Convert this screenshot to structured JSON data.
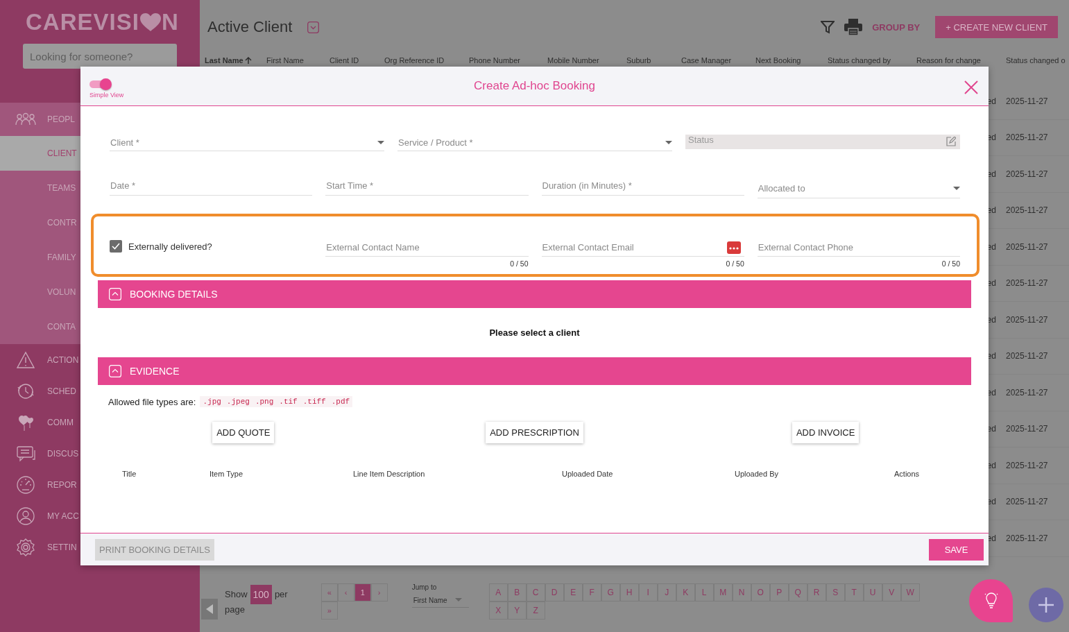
{
  "sidebar": {
    "logo": {
      "before": "CAREVISI",
      "after": "N"
    },
    "search": {
      "placeholder": "Looking for someone?"
    },
    "items": [
      {
        "label": "PEOPL",
        "expanded": true,
        "children": [
          {
            "label": "CLIENT",
            "selected": true
          },
          {
            "label": "TEAMS",
            "selected": false
          },
          {
            "label": "CONTR",
            "selected": false
          },
          {
            "label": "FAMILY",
            "selected": false
          },
          {
            "label": "VOLUN",
            "selected": false
          },
          {
            "label": "CONTA",
            "selected": false
          }
        ]
      },
      {
        "label": "ACTION",
        "expanded": false
      },
      {
        "label": "SCHED",
        "expanded": false
      },
      {
        "label": "COMM",
        "expanded": false
      },
      {
        "label": "DISCUS",
        "expanded": false
      },
      {
        "label": "REPOR",
        "expanded": false
      },
      {
        "label": "MY ACC",
        "expanded": false
      },
      {
        "label": "SETTIN",
        "expanded": false
      }
    ]
  },
  "header": {
    "title": "Active Client",
    "group_by": "GROUP BY",
    "create_button": "+ CREATE NEW CLIENT"
  },
  "table": {
    "columns": [
      {
        "label": "Last Name",
        "sorted": true
      },
      {
        "label": "First Name",
        "sorted": false
      },
      {
        "label": "Client ID",
        "sorted": false
      },
      {
        "label": "Org Reference ID",
        "sorted": false
      },
      {
        "label": "Phone Number",
        "sorted": false
      },
      {
        "label": "Mobile Number",
        "sorted": false
      },
      {
        "label": "Suburb",
        "sorted": false
      },
      {
        "label": "Case Manager",
        "sorted": false
      },
      {
        "label": "Next Booking",
        "sorted": false
      },
      {
        "label": "Status changed by",
        "sorted": false
      },
      {
        "label": "Reason for change",
        "sorted": false
      },
      {
        "label": "Status changed o",
        "sorted": false
      }
    ],
    "rows": [
      [
        "ed",
        "2025-11-27"
      ],
      [
        "ed",
        "2025-11-27"
      ],
      [
        "ed",
        "2025-11-27"
      ],
      [
        "ed",
        "2025-11-27"
      ],
      [
        "ed",
        "2025-11-27"
      ],
      [
        "ed",
        "2025-11-27"
      ],
      [
        "ed",
        "2025-11-27"
      ],
      [
        "ed",
        "2025-11-27"
      ],
      [
        "ed",
        "2025-11-27"
      ],
      [
        "ed",
        "2025-11-27"
      ],
      [
        "ed",
        "2025-11-27"
      ],
      [
        "ed",
        "2025-11-27"
      ],
      [
        "ed",
        "2025-11-27"
      ]
    ]
  },
  "pagination": {
    "show": "Show",
    "page_size": "100",
    "per": "per",
    "page": "page",
    "pages": [
      {
        "label": "«",
        "selected": false
      },
      {
        "label": "‹",
        "selected": false
      },
      {
        "label": "1",
        "selected": true
      },
      {
        "label": "›",
        "selected": false
      },
      {
        "label": "»",
        "selected": false
      }
    ],
    "jump": {
      "label": "Jump to",
      "value": "First Name"
    },
    "letters": [
      "A",
      "B",
      "C",
      "D",
      "E",
      "F",
      "G",
      "H",
      "I",
      "J",
      "K",
      "L",
      "M",
      "N",
      "O",
      "P",
      "Q",
      "R",
      "S",
      "T",
      "U",
      "V",
      "W",
      "X",
      "Y",
      "Z"
    ]
  },
  "modal": {
    "simple_view": {
      "label": "Simple View",
      "on": true
    },
    "title": "Create Ad-hoc Booking",
    "row_1": [
      {
        "placeholder": "Client *",
        "kind": "dropdown"
      },
      {
        "placeholder": "Service / Product *",
        "kind": "dropdown"
      },
      {
        "placeholder": "Status",
        "kind": "readonly"
      }
    ],
    "row_2": [
      {
        "placeholder": "Date *",
        "kind": "text"
      },
      {
        "placeholder": "Start Time *",
        "kind": "text"
      },
      {
        "placeholder": "Duration (in Minutes) *",
        "kind": "text"
      },
      {
        "placeholder": "Allocated to",
        "kind": "dropdown"
      }
    ],
    "external": {
      "checkbox": {
        "label": "Externally delivered?",
        "checked": true
      },
      "fields": [
        {
          "placeholder": "External Contact Name",
          "counter": "0 / 50",
          "kind": "text"
        },
        {
          "placeholder": "External Contact Email",
          "counter": "0 / 50",
          "kind": "email"
        },
        {
          "placeholder": "External Contact Phone",
          "counter": "0 / 50",
          "kind": "text"
        }
      ]
    },
    "sections": [
      {
        "title": "BOOKING DETAILS",
        "expanded": true,
        "kind": "message",
        "message": "Please select a client"
      },
      {
        "title": "EVIDENCE",
        "expanded": true,
        "kind": "evidence",
        "allowed_label": "Allowed file types are:",
        "file_types": [
          ".jpg",
          ".jpeg",
          ".png",
          ".tif",
          ".tiff",
          ".pdf"
        ],
        "buttons": [
          "ADD QUOTE",
          "ADD PRESCRIPTION",
          "ADD INVOICE"
        ],
        "columns": [
          "Title",
          "Item Type",
          "Line Item Description",
          "Uploaded Date",
          "Uploaded By",
          "Actions"
        ]
      }
    ],
    "footer": {
      "print": {
        "label": "PRINT BOOKING DETAILS",
        "disabled": true
      },
      "save": "SAVE"
    }
  }
}
